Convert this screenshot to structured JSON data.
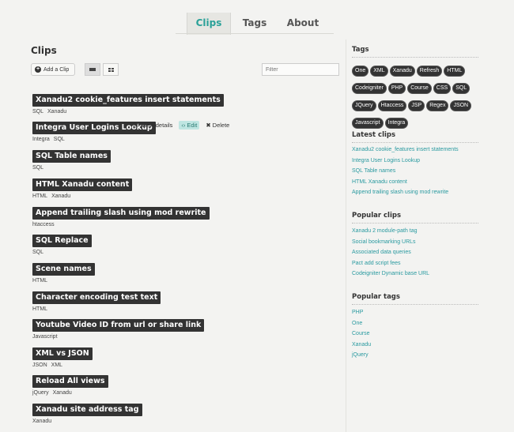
{
  "nav": {
    "tabs": [
      {
        "label": "Clips",
        "active": true
      },
      {
        "label": "Tags",
        "active": false
      },
      {
        "label": "About",
        "active": false
      }
    ]
  },
  "page": {
    "title": "Clips",
    "add_label": "Add a Clip",
    "filter_placeholder": "Filter"
  },
  "clips": [
    {
      "title": "Xanadu2 cookie_features insert statements",
      "tags": [
        "SQL",
        "Xanadu"
      ]
    },
    {
      "title": "Integra User Logins Lookup",
      "tags": [
        "Integra",
        "SQL"
      ],
      "actions": {
        "view": "View details",
        "edit": "Edit",
        "delete": "Delete"
      }
    },
    {
      "title": "SQL Table names",
      "tags": [
        "SQL"
      ]
    },
    {
      "title": "HTML Xanadu content",
      "tags": [
        "HTML",
        "Xanadu"
      ]
    },
    {
      "title": "Append trailing slash using mod rewrite",
      "tags": [
        "htaccess"
      ]
    },
    {
      "title": "SQL Replace",
      "tags": [
        "SQL"
      ]
    },
    {
      "title": "Scene names",
      "tags": [
        "HTML"
      ]
    },
    {
      "title": "Character encoding test text",
      "tags": [
        "HTML"
      ]
    },
    {
      "title": "Youtube Video ID from url or share link",
      "tags": [
        "Javascript"
      ]
    },
    {
      "title": "XML vs JSON",
      "tags": [
        "JSON",
        "XML"
      ]
    },
    {
      "title": "Reload All views",
      "tags": [
        "jQuery",
        "Xanadu"
      ]
    },
    {
      "title": "Xanadu site address tag",
      "tags": [
        "Xanadu"
      ]
    }
  ],
  "sidebar": {
    "tags_heading": "Tags",
    "tags": [
      "One",
      "XML",
      "Xanadu",
      "Refresh",
      "HTML",
      "Codeigniter",
      "PHP",
      "Course",
      "CSS",
      "SQL",
      "JQuery",
      "Htaccess",
      "JSP",
      "Regex",
      "JSON",
      "Javascript",
      "Integra"
    ],
    "latest_heading": "Latest clips",
    "latest": [
      "Xanadu2 cookie_features insert statements",
      "Integra User Logins Lookup",
      "SQL Table names",
      "HTML Xanadu content",
      "Append trailing slash using mod rewrite"
    ],
    "popular_clips_heading": "Popular clips",
    "popular_clips": [
      "Xanadu 2 module-path tag",
      "Social bookmarking URLs",
      "Associated data queries",
      "Pact add script fees",
      "Codeigniter Dynamic base URL"
    ],
    "popular_tags_heading": "Popular tags",
    "popular_tags": [
      "PHP",
      "One",
      "Course",
      "Xanadu",
      "jQuery"
    ]
  },
  "colors": {
    "accent": "#2aa198",
    "link": "#2a9aa0",
    "label_bg": "#333333"
  }
}
